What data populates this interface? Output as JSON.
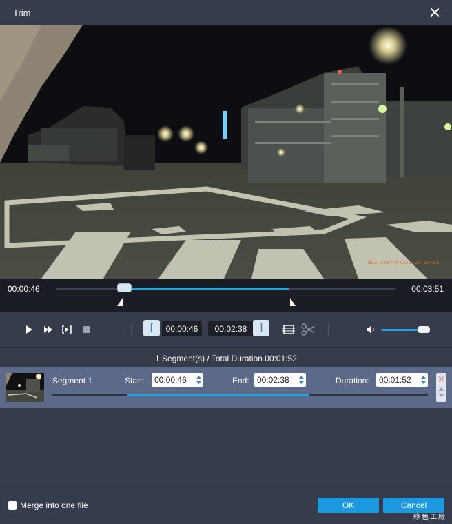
{
  "window": {
    "title": "Trim"
  },
  "video": {
    "overlay_stamp": "B52 2017/07/25 23:10:56",
    "stamp_color": "#e36a1c"
  },
  "timeline": {
    "current_time": "00:00:46",
    "total_time": "03:51",
    "total_time_display": "00:03:51",
    "selection_start_fraction": 0.2,
    "selection_end_fraction": 0.684
  },
  "controls": {
    "start_time": "00:00:46",
    "end_time": "00:02:38",
    "set_start_glyph": "[",
    "set_end_glyph": "]",
    "icons": [
      "play-icon",
      "fast-forward-icon",
      "frame-step-icon",
      "stop-icon",
      "crop-icon",
      "cut-icon",
      "volume-icon"
    ],
    "volume_fraction": 0.76
  },
  "summary": {
    "text": "1 Segment(s) / Total Duration 00:01:52"
  },
  "segment": {
    "name": "Segment 1",
    "start_label": "Start:",
    "start_value": "00:00:46",
    "end_label": "End:",
    "end_value": "00:02:38",
    "duration_label": "Duration:",
    "duration_value": "00:01:52"
  },
  "footer": {
    "merge_label": "Merge into one file",
    "ok_label": "OK",
    "cancel_label": "Cancel",
    "watermark": "綠色工廠"
  },
  "colors": {
    "accent": "#21a3e3",
    "button": "#1c98df",
    "background": "#363c4b",
    "segment_row": "#5d6988"
  }
}
